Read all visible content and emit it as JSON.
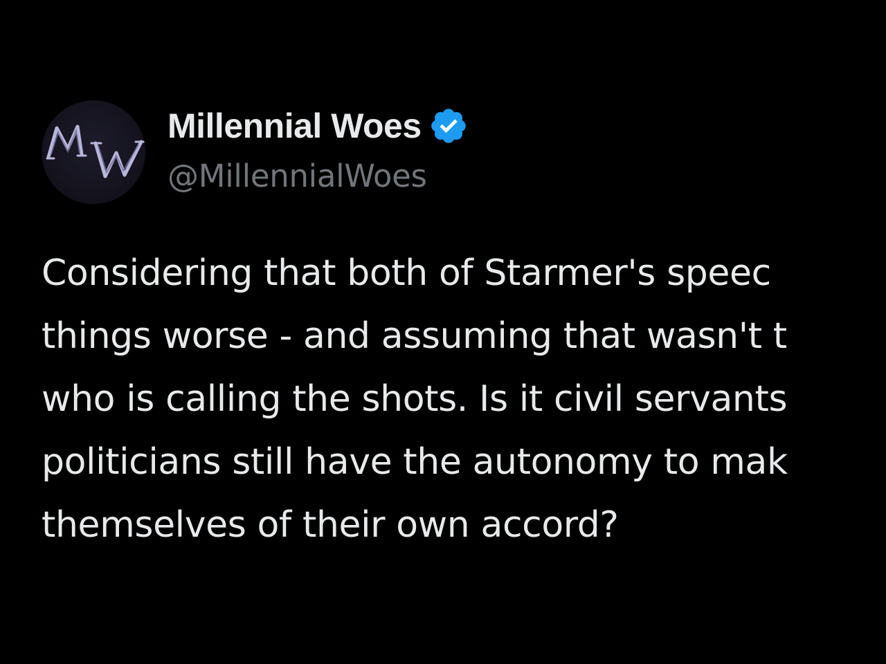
{
  "author": {
    "display_name": "Millennial Woes",
    "handle": "@MillennialWoes",
    "avatar_monogram": "MW",
    "verified_icon": "verified-badge-icon",
    "verified_color": "#1d9bf0"
  },
  "tweet": {
    "lines": [
      "Considering that both of Starmer's speec",
      "things worse - and assuming that wasn't t",
      "who is calling the shots. Is it civil servants",
      "politicians still have the autonomy to mak",
      "themselves of their own accord?"
    ]
  },
  "colors": {
    "background": "#000000",
    "primary_text": "#e7e9ea",
    "secondary_text": "#71767b"
  }
}
